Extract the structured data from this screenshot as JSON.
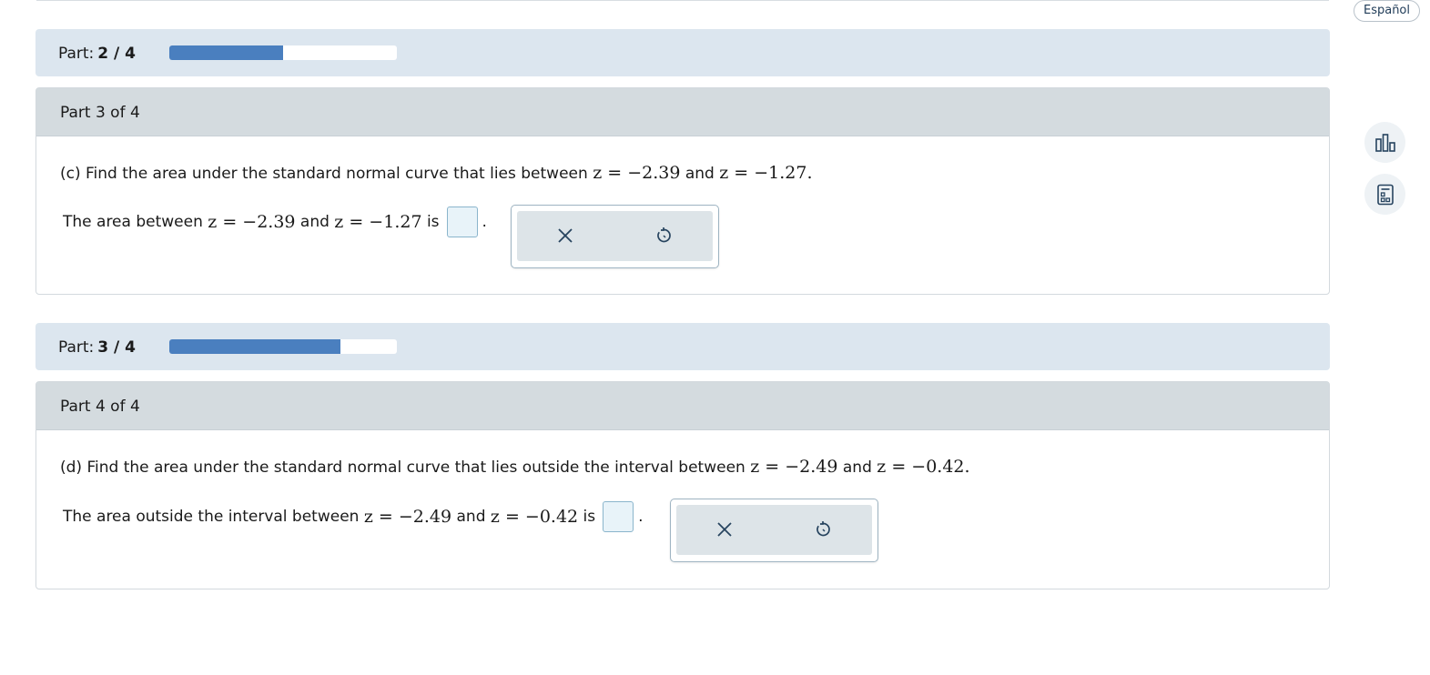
{
  "language_button": {
    "label": "Español"
  },
  "side_tools": [
    {
      "icon": "bar-chart-icon"
    },
    {
      "icon": "calculator-icon"
    }
  ],
  "progress": [
    {
      "label": "Part:",
      "value": "2 / 4",
      "fraction": 0.5
    },
    {
      "label": "Part:",
      "value": "3 / 4",
      "fraction": 0.75
    }
  ],
  "parts": [
    {
      "header": "Part 3 of 4",
      "question": {
        "prefix": "(c) Find the area under the standard normal curve that lies between",
        "z1": "z = −2.39",
        "and": "and",
        "z2": "z = −1.27",
        "end": "."
      },
      "answer": {
        "prefix": "The area between",
        "z1": "z = −2.39",
        "and": "and",
        "z2": "z = −1.27",
        "suffix": "is",
        "value": "",
        "end": "."
      },
      "tools": {
        "clear": "close-icon",
        "undo": "undo-icon"
      }
    },
    {
      "header": "Part 4 of 4",
      "question": {
        "prefix": "(d) Find the area under the standard normal curve that lies outside the interval between",
        "z1": "z = −2.49",
        "and": "and",
        "z2": "z = −0.42",
        "end": "."
      },
      "answer": {
        "prefix": "The area outside the interval between",
        "z1": "z = −2.49",
        "and": "and",
        "z2": "z = −0.42",
        "suffix": "is",
        "value": "",
        "end": "."
      },
      "tools": {
        "clear": "close-icon",
        "undo": "undo-icon"
      }
    }
  ],
  "colors": {
    "progress_fill": "#4a7fbf",
    "band": "#dce6ef",
    "part_header": "#d4dbdf"
  }
}
